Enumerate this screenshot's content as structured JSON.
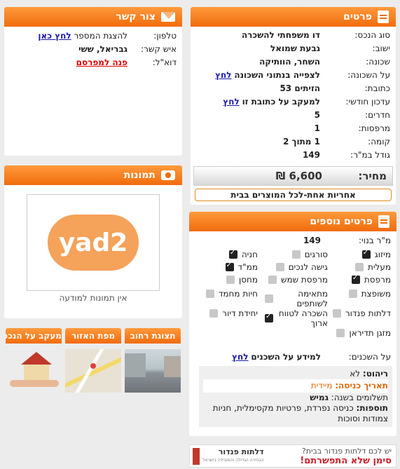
{
  "details": {
    "title": "פרטים",
    "rows": [
      {
        "label": "סוג הנכס:",
        "value": "דו משפחתי להשכרה"
      },
      {
        "label": "ישוב:",
        "value": "גבעת שמואל"
      },
      {
        "label": "שכונה:",
        "value": "השחר, הוותיקה"
      },
      {
        "label": "על השכונה:",
        "value": "לצפייה בנתוני השכונה",
        "link": "לחץ"
      },
      {
        "label": "כתובת:",
        "value": "הזיתים 53"
      },
      {
        "label": "עדכון חודשי:",
        "value": "למעקב על כתובת זו",
        "link": "לחץ"
      },
      {
        "label": "חדרים:",
        "value": "5"
      },
      {
        "label": "מרפסות:",
        "value": "1"
      },
      {
        "label": "קומה:",
        "value": "1 מתוך 2"
      },
      {
        "label": "גודל במ\"ר:",
        "value": "149"
      }
    ],
    "price_label": "מחיר:",
    "price_value": "6,600 ₪",
    "warranty": "אחריות אחת-לכל המוצרים בבית"
  },
  "contact": {
    "title": "צור קשר",
    "phone_label": "טלפון:",
    "phone_text": "להצגת המספר",
    "phone_link": "לחץ כאן",
    "person_label": "איש קשר:",
    "person_value": "גבריאל, ששי",
    "email_label": "דוא\"ל:",
    "email_link": "פנה למפרסם"
  },
  "photos": {
    "title": "תמונות",
    "logo_text": "yad2",
    "no_photos": "אין תמונות למודעה"
  },
  "tiles": [
    {
      "label": "תצוגת רחוב"
    },
    {
      "label": "מפת האזור"
    },
    {
      "label": "מעקב על הנכס"
    }
  ],
  "extra": {
    "title": "פרטים נוספים",
    "built_label": "מ\"ר בנוי:",
    "built_value": "149",
    "features": [
      {
        "label": "מיזוג",
        "checked": true
      },
      {
        "label": "סורגים",
        "checked": false
      },
      {
        "label": "חניה",
        "checked": true
      },
      {
        "label": "מעלית",
        "checked": false
      },
      {
        "label": "גישה לנכים",
        "checked": false
      },
      {
        "label": "ממ\"ד",
        "checked": true
      },
      {
        "label": "מרפסת",
        "checked": true
      },
      {
        "label": "מרפסת שמש",
        "checked": false
      },
      {
        "label": "מחסן",
        "checked": false
      },
      {
        "label": "משופצת",
        "checked": false
      },
      {
        "label": "מתאימה לשותפים",
        "checked": false
      },
      {
        "label": "חיות מחמד",
        "checked": false
      },
      {
        "label": "דלתות פנדור",
        "checked": false
      },
      {
        "label": "השכרה לטווח ארוך",
        "checked": true
      },
      {
        "label": "יחידת דיור",
        "checked": false
      },
      {
        "label": "מזגן תדיראן",
        "checked": false
      }
    ],
    "neighbors_label": "על השכנים:",
    "neighbors_value": "למידע על השכנים",
    "neighbors_link": "לחץ",
    "notes": {
      "furniture_label": "ריהוט:",
      "furniture_value": "לא",
      "entry_label": "תאריך כניסה:",
      "entry_value": "מיידית",
      "payments_label": "תשלומים בשנה:",
      "payments_value": "גמיש",
      "extras_label": "תוספות:",
      "extras_value": "כניסה נפרדת, פרטיות מקסימלית, חניות צמודות וסוכות"
    }
  },
  "banner": {
    "line1": "יש לכם דלתות פנדור בבית?",
    "line2": "סימן שלא התפשרתם!",
    "brand": "דלתות פנדור",
    "brand_sub": "הבחירה הגדולה והמובילה בישראל"
  }
}
